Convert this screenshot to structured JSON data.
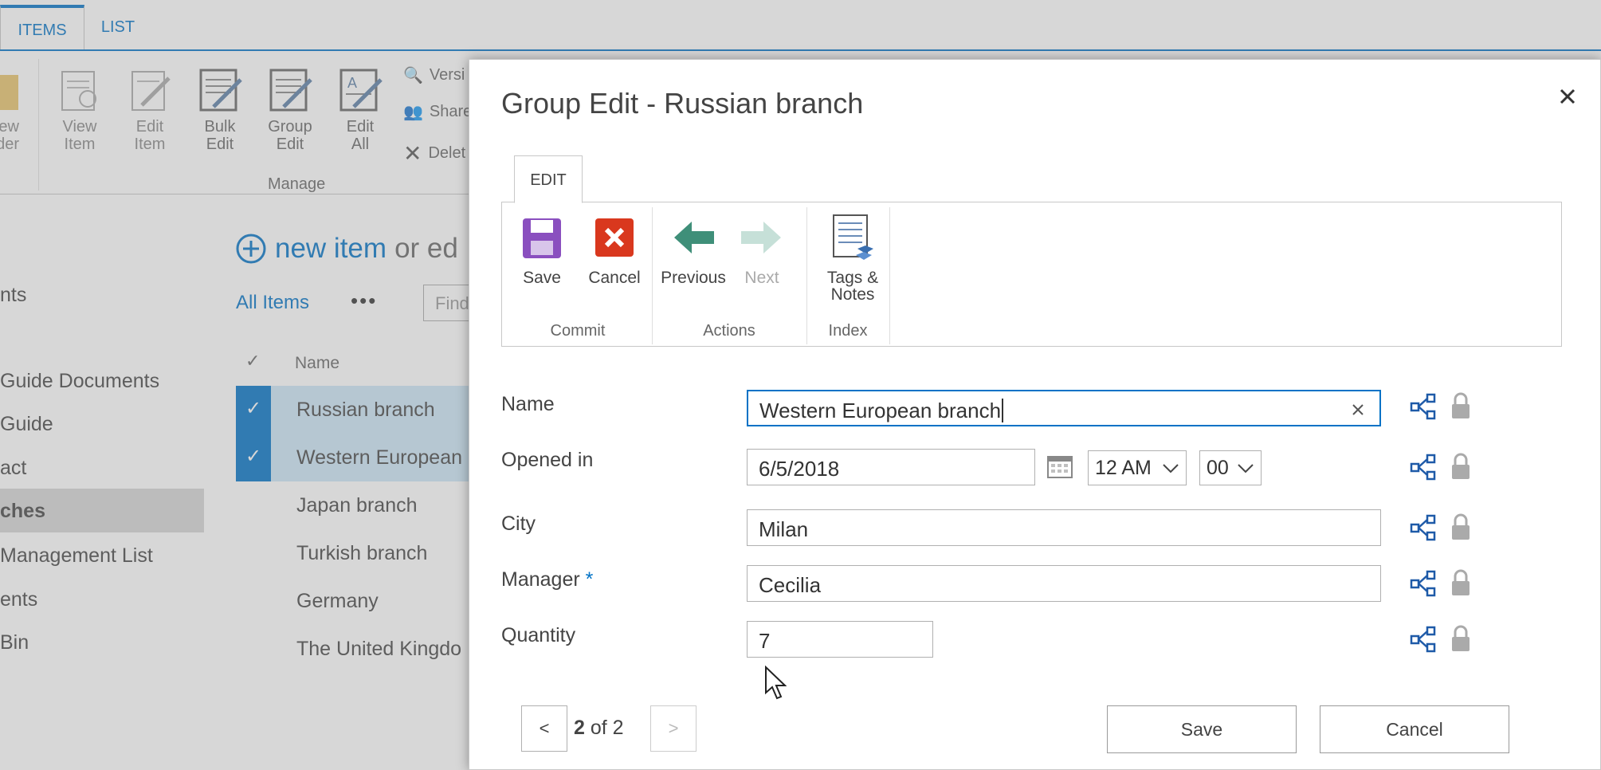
{
  "ribbon": {
    "tabs": [
      "ITEMS",
      "LIST"
    ],
    "buttons": {
      "new_folder": "ew\nder",
      "view_item": "View\nItem",
      "edit_item": "Edit\nItem",
      "bulk_edit": "Bulk\nEdit",
      "group_edit": "Group\nEdit",
      "edit_all": "Edit\nAll"
    },
    "small": {
      "versions": "Versi",
      "share": "Share",
      "delete": "Delet"
    },
    "group_manage": "Manage"
  },
  "left_nav": [
    "nts",
    "Guide Documents",
    "Guide",
    "act",
    "ches",
    "Management List",
    "ents",
    "Bin"
  ],
  "list": {
    "new_item": "new item",
    "or_edit": "or ed",
    "view_name": "All Items",
    "more": "•••",
    "find_placeholder": "Find",
    "column_name": "Name",
    "rows": [
      "Russian branch",
      "Western European",
      "Japan branch",
      "Turkish branch",
      "Germany",
      "The United Kingdo"
    ]
  },
  "dialog": {
    "title": "Group Edit - Russian branch",
    "tab": "EDIT",
    "buttons": {
      "save": "Save",
      "cancel": "Cancel",
      "previous": "Previous",
      "next": "Next",
      "tags_notes": "Tags &\nNotes"
    },
    "groups": {
      "commit": "Commit",
      "actions": "Actions",
      "index": "Index"
    },
    "fields": {
      "name_label": "Name",
      "name_value": "Western European branch",
      "opened_label": "Opened in",
      "opened_date": "6/5/2018",
      "opened_hour": "12 AM",
      "opened_minute": "00",
      "city_label": "City",
      "city_value": "Milan",
      "manager_label": "Manager",
      "manager_required": "*",
      "manager_value": "Cecilia",
      "quantity_label": "Quantity",
      "quantity_value": "7"
    },
    "pager": {
      "prev": "<",
      "current": "2",
      "of_total": "of 2",
      "next": ">"
    },
    "footer": {
      "save": "Save",
      "cancel": "Cancel"
    }
  },
  "colors": {
    "accent": "#0072c6",
    "save_icon": "#8a4fbf",
    "cancel_icon": "#d9381e",
    "arrow": "#3f8f79"
  }
}
